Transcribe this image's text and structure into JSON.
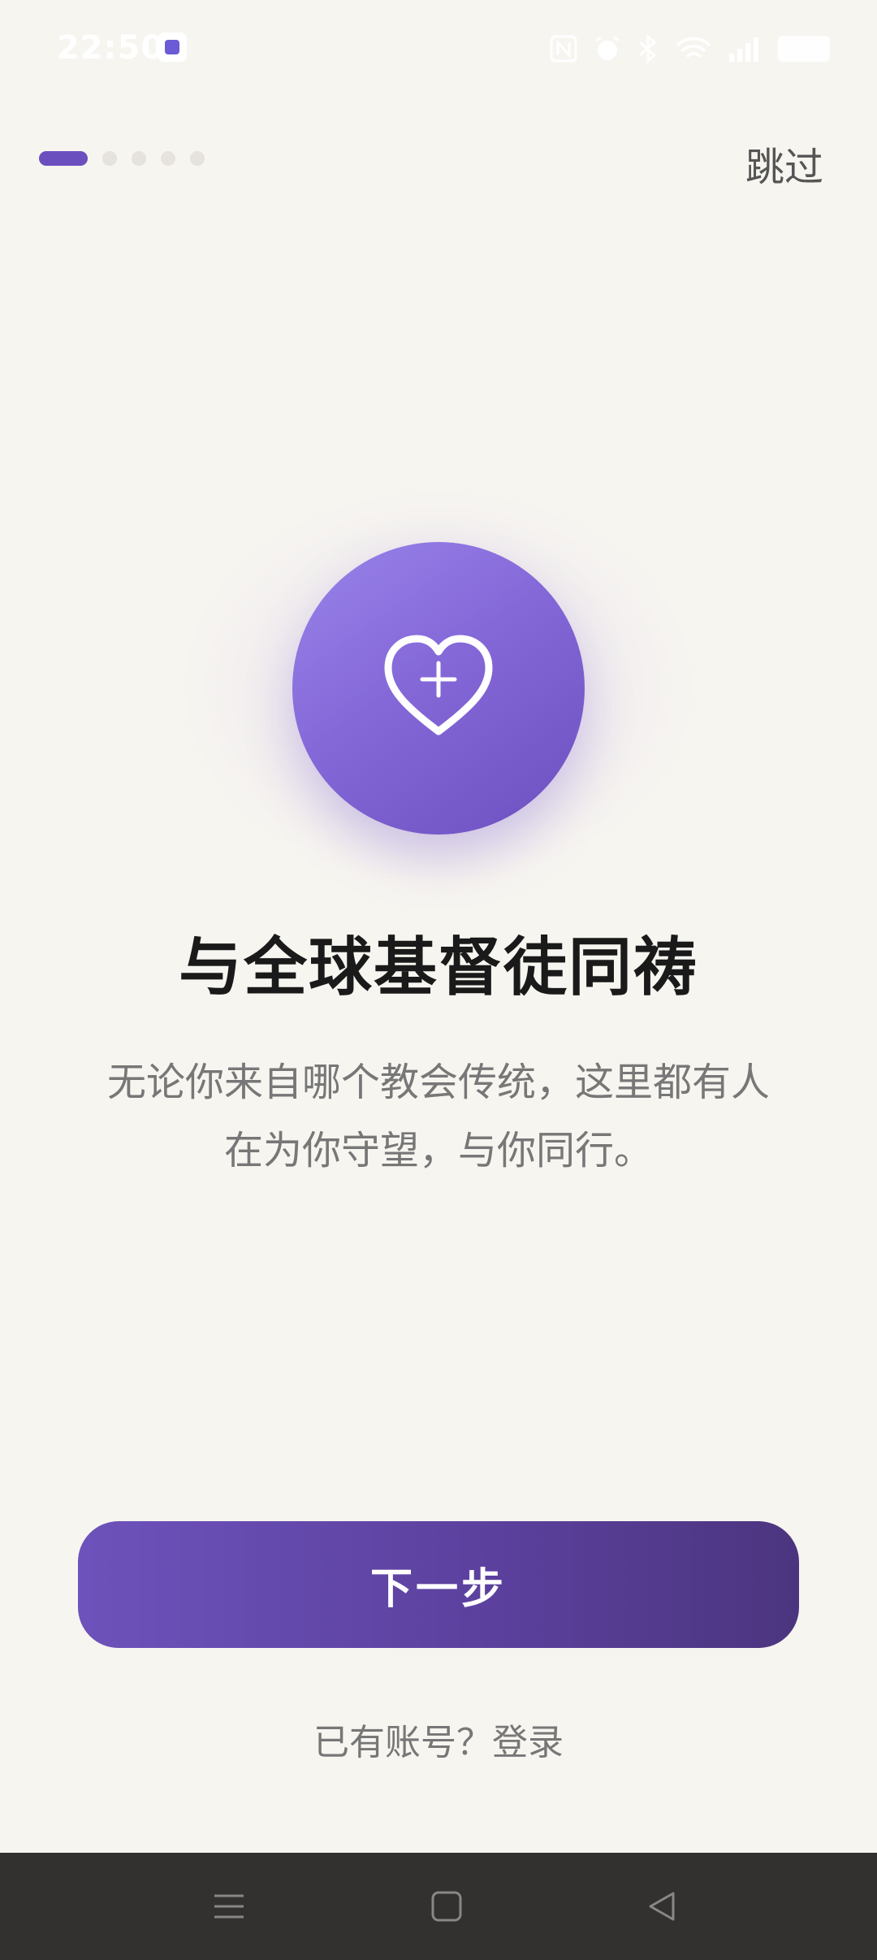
{
  "status_bar": {
    "time": "22:50",
    "icons": [
      "nfc-icon",
      "alarm-icon",
      "bluetooth-icon",
      "wifi-icon",
      "signal-icon",
      "battery-icon"
    ]
  },
  "onboarding": {
    "page_count": 5,
    "active_page": 1,
    "skip_label": "跳过",
    "hero_icon": "heart-plus-icon",
    "headline": "与全球基督徒同祷",
    "subtitle_line1": "无论你来自哪个教会传统，这里都有人",
    "subtitle_line2": "在为你守望，与你同行。",
    "next_label": "下一步",
    "login_prompt": "已有账号？",
    "login_link": "登录"
  },
  "colors": {
    "accent": "#6b4fbf",
    "background": "#f7f5f0",
    "button_gradient_start": "#6d52bb",
    "button_gradient_end": "#4c357f",
    "nav_bar": "#333030"
  },
  "nav_bar": {
    "buttons": [
      "menu-icon",
      "home-icon",
      "back-icon"
    ]
  }
}
